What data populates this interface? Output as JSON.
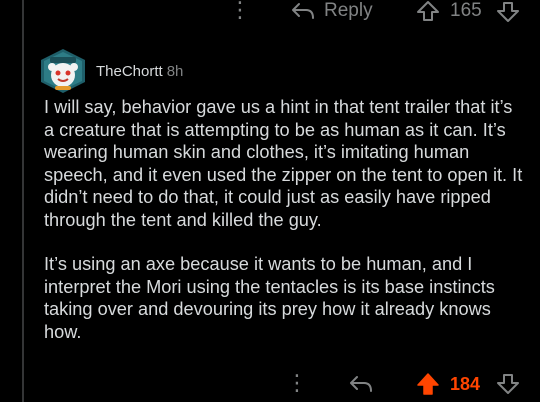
{
  "previous_comment": {
    "more_icon": "kebab-vertical-icon",
    "reply_label": "Reply",
    "score": "165"
  },
  "comment": {
    "author": "TheChortt",
    "age": "8h",
    "paragraphs": [
      "I will say, behavior gave us a hint in that tent trailer that it’s a creature that is attempting to be as human as it can. It’s wearing human skin and clothes, it’s imitating human speech, and it even used the zipper on the tent to open it. It didn’t need to do that, it could just as easily have ripped through the tent and killed the guy.",
      "It’s using an axe because it wants to be human, and I interpret the Mori using the tentacles is its base instincts taking over and devouring its prey how it already knows how."
    ],
    "actions": {
      "more_icon": "kebab-vertical-icon",
      "reply_icon": "reply-arrow-icon",
      "score": "184",
      "upvoted": true
    }
  },
  "colors": {
    "background": "#000000",
    "text": "#d7dadc",
    "muted": "#818384",
    "upvote": "#ff4500",
    "thread_line": "#343536"
  }
}
